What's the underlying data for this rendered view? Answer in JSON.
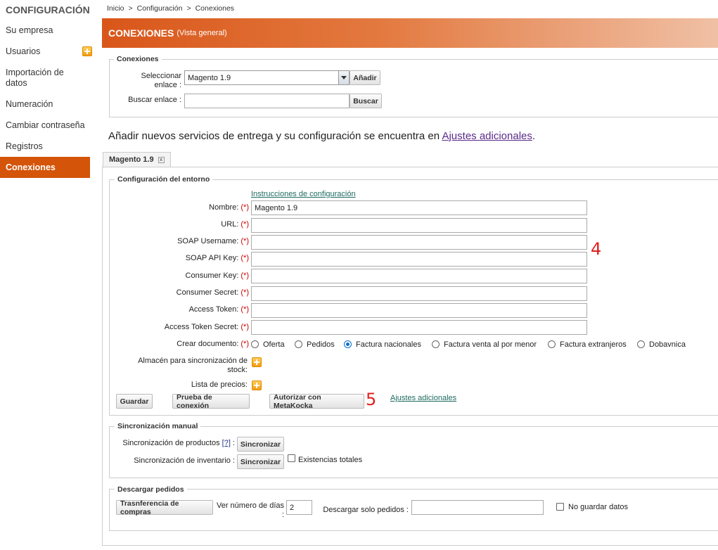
{
  "sidebar": {
    "title": "CONFIGURACIÓN",
    "items": [
      {
        "label": "Su empresa"
      },
      {
        "label": "Usuarios"
      },
      {
        "label": "Importación de datos"
      },
      {
        "label": "Numeración"
      },
      {
        "label": "Cambiar contraseña"
      },
      {
        "label": "Registros"
      },
      {
        "label": "Conexiones"
      }
    ]
  },
  "breadcrumb": [
    "Inicio",
    ">",
    "Configuración",
    ">",
    "Conexiones"
  ],
  "header": {
    "title": "CONEXIONES",
    "subtitle": "(Vista general)"
  },
  "connections": {
    "legend": "Conexiones",
    "select_label": "Seleccionar enlace :",
    "select_value": "Magento 1.9",
    "add_button": "Añadir",
    "search_label": "Buscar enlace :",
    "search_value": "",
    "search_button": "Buscar"
  },
  "info": {
    "text": "Añadir nuevos servicios de entrega y su configuración se encuentra en ",
    "link": "Ajustes adicionales",
    "suffix": "."
  },
  "tab": {
    "label": "Magento 1.9",
    "close": "x"
  },
  "environment": {
    "legend": "Configuración del entorno",
    "instructions_link": "Instrucciones de configuración",
    "required_mark": "(*)",
    "fields": [
      {
        "label": "Nombre:",
        "value": "Magento 1.9"
      },
      {
        "label": "URL:",
        "value": ""
      },
      {
        "label": "SOAP Username:",
        "value": ""
      },
      {
        "label": "SOAP API Key:",
        "value": ""
      },
      {
        "label": "Consumer Key:",
        "value": ""
      },
      {
        "label": "Consumer Secret:",
        "value": ""
      },
      {
        "label": "Access Token:",
        "value": ""
      },
      {
        "label": "Access Token Secret:",
        "value": ""
      }
    ],
    "create_doc_label": "Crear documento:",
    "create_doc_options": [
      "Oferta",
      "Pedidos",
      "Factura nacionales",
      "Factura venta al por menor",
      "Factura extranjeros",
      "Dobavnica"
    ],
    "create_doc_selected": "Factura nacionales",
    "warehouse_label": "Almacén para sincronización de stock:",
    "price_list_label": "Lista de precios:",
    "save_button": "Guardar",
    "test_button": "Prueba de conexión",
    "authorize_button": "Autorizar con MetaKocka",
    "additional_link": "Ajustes adicionales"
  },
  "annotations": {
    "a4": "4",
    "a5": "5"
  },
  "manual_sync": {
    "legend": "Sincronización manual",
    "products_label": "Sincronización de productos",
    "help": "[?]",
    "colon": " :",
    "sync_button": "Sincronizar",
    "inventory_label": "Sincronización de inventario :",
    "total_stock_label": "Existencias totales"
  },
  "downloads": {
    "legend": "Descargar pedidos",
    "transfer_button": "Trasnferencia de compras",
    "days_label_1": "Ver número de días",
    "days_label_2": ":",
    "days_value": "2",
    "only_orders_label": "Descargar solo pedidos :",
    "only_orders_value": "",
    "no_save_label": "No guardar datos"
  }
}
